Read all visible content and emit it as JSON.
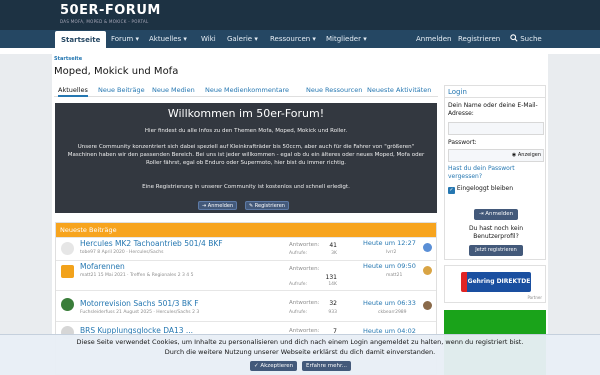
{
  "header": {
    "logo": "50ER-FORUM",
    "tagline": "DAS MOFA, MOPED & MOKICK - PORTAL"
  },
  "nav": {
    "items": [
      "Startseite",
      "Forum",
      "Aktuelles",
      "Wiki",
      "Galerie",
      "Ressourcen",
      "Mitglieder"
    ],
    "login": "Anmelden",
    "register": "Registrieren",
    "search": "Suche"
  },
  "breadcrumb": "Startseite",
  "page_title": "Moped, Mokick und Mofa",
  "tabs": [
    "Aktuelles",
    "Neue Beiträge",
    "Neue Medien",
    "Neue Medienkommentare",
    "Neue Ressourcen",
    "Neueste Aktivitäten"
  ],
  "welcome": {
    "title": "Willkommen im 50er-Forum!",
    "p1": "Hier findest du alle Infos zu den Themen Mofa, Moped, Mokick und Roller.",
    "p2": "Unsere Community konzentriert sich dabei speziell auf Kleinkrafträder bis 50ccm, aber auch für die Fahrer von \"größeren\" Maschinen haben wir den passenden Bereich. Bei uns ist jeder willkommen - egal ob du ein älteres oder neues Moped, Mofa oder Roller fährst, egal ob Enduro oder Supermoto, hier bist du immer richtig.",
    "p3": "Eine Registrierung in unserer Community ist kostenlos und schnell erledigt.",
    "login_btn": "Anmelden",
    "register_btn": "Registrieren"
  },
  "new_posts": {
    "heading": "Neueste Beiträge",
    "label_answers": "Antworten:",
    "label_views": "Aufrufe:",
    "rows": [
      {
        "title": "Hercules MK2 Tachoantrieb 501/4 BKF",
        "meta": "tobe97 8 April 2020 · Hercules/Sachs",
        "answers": "41",
        "views": "3K",
        "time": "Heute um 12:27",
        "user": "lvrr2"
      },
      {
        "title": "Mofarennen",
        "meta": "matt21 15 Mai 2021 · Treffen & Regionales   2  3  4  5",
        "answers": "131",
        "views": "14K",
        "time": "Heute um 09:50",
        "user": "matt21"
      },
      {
        "title": "Motorrevision Sachs 501/3 BK F",
        "meta": "Fuchsleiderfuss 21 August 2025 · Hercules/Sachs   2  3",
        "answers": "32",
        "views": "933",
        "time": "Heute um 06:33",
        "user": "ckbearr2989"
      },
      {
        "title": "BRS Kupplungsglocke DA13 ...",
        "meta": "",
        "answers": "7",
        "views": "",
        "time": "Heute um 04:02",
        "user": ""
      }
    ]
  },
  "sidebar": {
    "title": "Login",
    "name_label": "Dein Name oder deine E-Mail-Adresse:",
    "password_label": "Passwort:",
    "show": "Anzeigen",
    "forgot": "Hast du dein Passwort vergessen?",
    "remember": "Eingeloggt bleiben",
    "login_btn": "Anmelden",
    "no_account": "Du hast noch kein Benutzerprofil?",
    "register_btn": "Jetzt registrieren"
  },
  "ad": {
    "brand": "Gehring DIREKTDE",
    "caption": "Partner"
  },
  "cookie": {
    "line1": "Diese Seite verwendet Cookies, um Inhalte zu personalisieren und dich nach einem Login angemeldet zu halten, wenn du registriert bist.",
    "line2": "Durch die weitere Nutzung unserer Webseite erklärst du dich damit einverstanden.",
    "accept": "Akzeptieren",
    "more": "Erfahre mehr..."
  },
  "colors": {
    "header": "#1d3243",
    "nav": "#254763",
    "accent": "#f7a41e",
    "link": "#2577b1"
  }
}
